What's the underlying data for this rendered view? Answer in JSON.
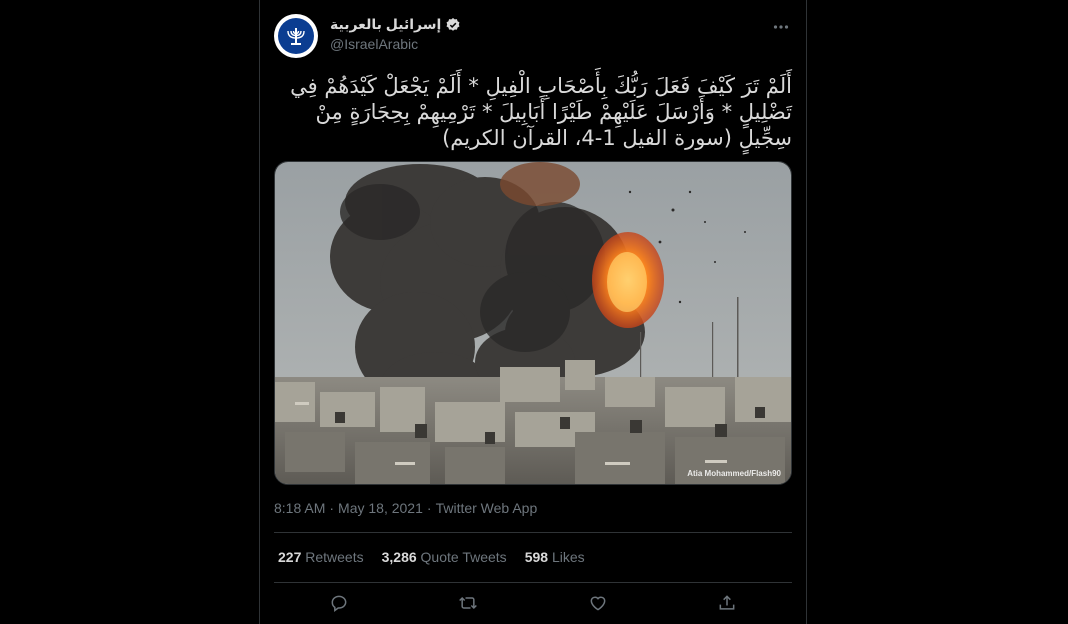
{
  "account": {
    "display_name": "إسرائيل بالعربية",
    "handle": "@IsraelArabic",
    "verified": true,
    "avatar_icon": "menorah-emblem-icon"
  },
  "tweet": {
    "text_line_1": "أَلَمْ تَرَ كَيْفَ فَعَلَ رَبُّكَ بِأَصْحَابِ الْفِيلِ * أَلَمْ يَجْعَلْ كَيْدَهُمْ فِي",
    "text_line_2": "تَضْلِيلٍ * وَأَرْسَلَ عَلَيْهِمْ طَيْرًا أَبَابِيلَ * تَرْمِيهِمْ بِحِجَارَةٍ مِنْ",
    "text_line_3": "سِجِّيلٍ (سورة الفيل 1-4، القرآن الكريم)",
    "photo_credit": "Atia Mohammed/Flash90",
    "time": "8:18 AM",
    "separator": "·",
    "date": "May 18, 2021",
    "source": "Twitter Web App"
  },
  "stats": {
    "retweets_count": "227",
    "retweets_label": "Retweets",
    "quotes_count": "3,286",
    "quotes_label": "Quote Tweets",
    "likes_count": "598",
    "likes_label": "Likes"
  },
  "actions": [
    "reply-icon",
    "retweet-icon",
    "like-icon",
    "share-icon"
  ],
  "colors": {
    "background": "#000000",
    "border": "#2f3336",
    "text_primary": "#d9d9d9",
    "text_secondary": "#6e767d",
    "verified": "#d9d9d9"
  }
}
